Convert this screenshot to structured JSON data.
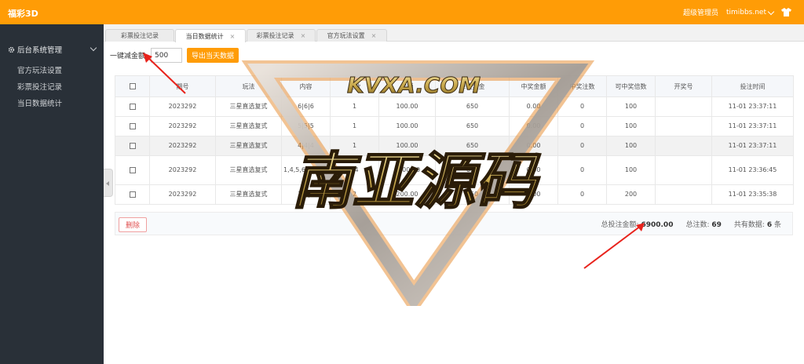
{
  "app": {
    "title": "福彩3D"
  },
  "header": {
    "user_role": "超级管理员",
    "site": "timibbs.net",
    "shirt_icon": "shirt-icon"
  },
  "sidebar": {
    "group_label": "后台系统管理",
    "items": [
      {
        "label": "官方玩法设置"
      },
      {
        "label": "彩票投注记录"
      },
      {
        "label": "当日数据统计"
      }
    ]
  },
  "tabs": [
    {
      "label": "彩票投注记录",
      "closable": false
    },
    {
      "label": "当日数据统计",
      "closable": true,
      "close": "×"
    },
    {
      "label": "彩票投注记录",
      "closable": true,
      "close": "×"
    },
    {
      "label": "官方玩法设置",
      "closable": true,
      "close": "×"
    }
  ],
  "toolbar": {
    "amount_label": "一键减金额:",
    "amount_value": "500",
    "export_label": "导出当天数据"
  },
  "table": {
    "columns": [
      "",
      "期号",
      "玩法",
      "内容",
      "注数",
      "金额",
      "单注奖金",
      "中奖金额",
      "中奖注数",
      "可中奖倍数",
      "开奖号",
      "投注时间"
    ],
    "rows": [
      {
        "period": "2023292",
        "play": "三星直选复式",
        "content": "6|6|6",
        "count": "1",
        "amount": "100.00",
        "odds": "650",
        "win": "0.00",
        "win_count": "0",
        "multiple": "100",
        "draw": "",
        "time": "11-01 23:37:11"
      },
      {
        "period": "2023292",
        "play": "三星直选复式",
        "content": "5|5|5",
        "count": "1",
        "amount": "100.00",
        "odds": "650",
        "win": "0.00",
        "win_count": "0",
        "multiple": "100",
        "draw": "",
        "time": "11-01 23:37:11"
      },
      {
        "period": "2023292",
        "play": "三星直选复式",
        "content": "4|4|4",
        "count": "1",
        "amount": "100.00",
        "odds": "650",
        "win": "0.00",
        "win_count": "0",
        "multiple": "100",
        "draw": "",
        "time": "11-01 23:37:11"
      },
      {
        "period": "2023292",
        "play": "三星直选复式",
        "content": "1,4,5,6|3,4,5,6|3,4,5,6",
        "count": "64",
        "amount": "6400.00",
        "odds": "650",
        "win": "0.00",
        "win_count": "0",
        "multiple": "100",
        "draw": "",
        "time": "11-01 23:36:45"
      },
      {
        "period": "2023292",
        "play": "三星直选复式",
        "content": "3|3|3",
        "count": "2",
        "amount": "200.00",
        "odds": "650",
        "win": "0.00",
        "win_count": "0",
        "multiple": "200",
        "draw": "",
        "time": "11-01 23:35:38"
      }
    ]
  },
  "footer": {
    "delete_label": "删除",
    "total_amount_label": "总投注金额:",
    "total_amount": "6900.00",
    "total_count_label": "总注数:",
    "total_count": "69",
    "records_label": "共有数据:",
    "records": "6",
    "records_unit": "条"
  },
  "watermark": {
    "top": "KVXA.COM",
    "main": "南亚源码"
  },
  "colors": {
    "accent": "#ff9c06",
    "sidebar": "#293038",
    "arrow": "#e8231c"
  }
}
